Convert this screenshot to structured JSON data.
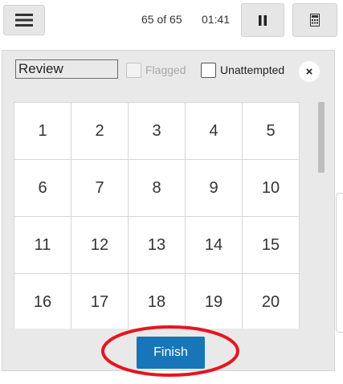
{
  "topbar": {
    "menu_icon": "hamburger-menu-icon",
    "counter": "65 of 65",
    "timer": "01:41",
    "pause_icon": "pause-icon",
    "calculator_icon": "calculator-icon"
  },
  "review_panel": {
    "field_value": "Review",
    "flagged_label": "Flagged",
    "unattempted_label": "Unattempted",
    "close_icon": "close-icon",
    "close_glyph": "×",
    "questions": [
      "1",
      "2",
      "3",
      "4",
      "5",
      "6",
      "7",
      "8",
      "9",
      "10",
      "11",
      "12",
      "13",
      "14",
      "15",
      "16",
      "17",
      "18",
      "19",
      "20"
    ],
    "finish_label": "Finish"
  },
  "colors": {
    "accent": "#1775b8",
    "highlight": "#e8141f",
    "panel_bg": "#e9e9e9"
  }
}
